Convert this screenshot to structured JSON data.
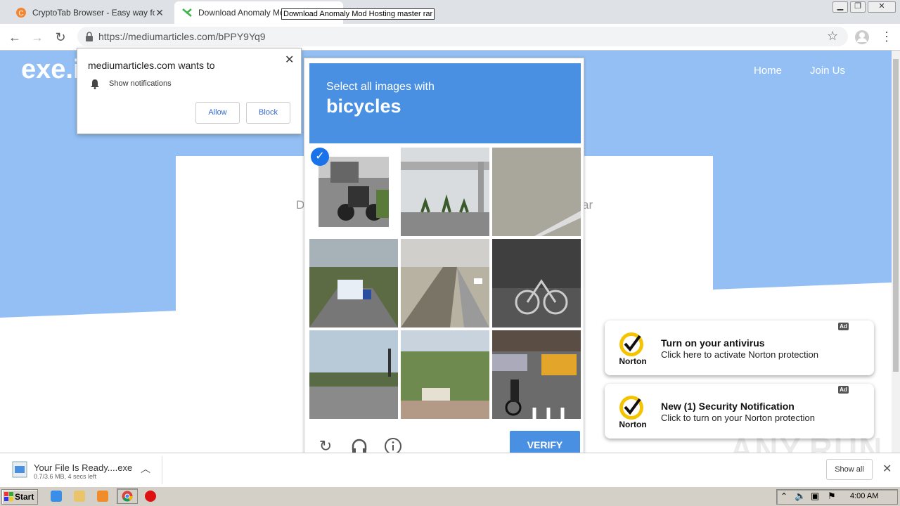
{
  "browser": {
    "tabs": [
      {
        "label": "CryptoTab Browser - Easy way for B",
        "icon": "cryptotab-icon",
        "active": false
      },
      {
        "label": "Download Anomaly Mod",
        "icon": "exe-site-icon",
        "active": true
      }
    ],
    "tooltip": "Download Anomaly Mod Hosting master rar",
    "url": "https://mediumarticles.com/bPPY9Yq9",
    "window_controls": [
      "minimize",
      "restore",
      "close"
    ]
  },
  "site": {
    "logo": "exe.i",
    "nav": [
      "Home",
      "Join Us"
    ],
    "card_left_text": "D",
    "card_right_text": "ar",
    "hero_color": "#93bff4"
  },
  "notification_prompt": {
    "title": "mediumarticles.com wants to",
    "permission": "Show notifications",
    "allow_label": "Allow",
    "block_label": "Block"
  },
  "captcha": {
    "prompt_prefix": "Select all images with",
    "target": "bicycles",
    "verify_label": "VERIFY",
    "header_color": "#4a90e2",
    "tiles": [
      {
        "subject": "motorcycle in parking lot",
        "selected": true
      },
      {
        "subject": "highway sign gantry",
        "selected": false
      },
      {
        "subject": "pavement texture",
        "selected": false
      },
      {
        "subject": "truck on road",
        "selected": false
      },
      {
        "subject": "bridge walkway",
        "selected": false
      },
      {
        "subject": "parked bicycle",
        "selected": false
      },
      {
        "subject": "road intersection",
        "selected": false
      },
      {
        "subject": "palm trees and sign",
        "selected": false
      },
      {
        "subject": "cyclist at crosswalk",
        "selected": false
      }
    ],
    "footer_icons": [
      "reload-icon",
      "audio-icon",
      "info-icon"
    ]
  },
  "ads": [
    {
      "title": "Turn on your antivirus",
      "text": "Click here to activate Norton protection",
      "badge": "Ad",
      "brand": "Norton"
    },
    {
      "title": "New (1) Security Notification",
      "text": "Click to turn on your Norton protection",
      "badge": "Ad",
      "brand": "Norton"
    }
  ],
  "watermark": "ANY.RUN",
  "download_shelf": {
    "file_name": "Your File Is Ready....exe",
    "status": "0.7/3.6 MB, 4 secs left",
    "show_all_label": "Show all"
  },
  "taskbar": {
    "start_label": "Start",
    "clock": "4:00 AM"
  }
}
